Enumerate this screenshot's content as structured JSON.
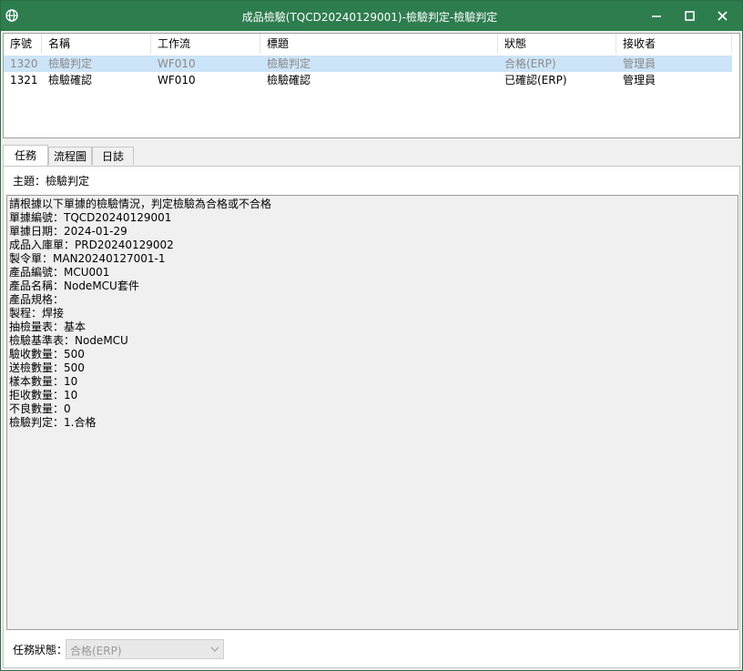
{
  "window": {
    "title": "成品檢驗(TQCD20240129001)-檢驗判定-檢驗判定"
  },
  "grid": {
    "headers": [
      "序號",
      "名稱",
      "工作流",
      "標題",
      "狀態",
      "接收者"
    ],
    "rows": [
      {
        "seq": "1320",
        "name": "檢驗判定",
        "workflow": "WF010",
        "title": "檢驗判定",
        "status": "合格(ERP)",
        "receiver": "管理員"
      },
      {
        "seq": "1321",
        "name": "檢驗確認",
        "workflow": "WF010",
        "title": "檢驗確認",
        "status": "已確認(ERP)",
        "receiver": "管理員"
      }
    ]
  },
  "tabs": [
    "任務",
    "流程圖",
    "日誌"
  ],
  "task": {
    "subject_label": "主題：",
    "subject_value": "檢驗判定",
    "content_lines": [
      "請根據以下單據的檢驗情況，判定檢驗為合格或不合格",
      "單據編號：TQCD20240129001",
      "單據日期：2024-01-29",
      "成品入庫單：PRD20240129002",
      "製令單：MAN20240127001-1",
      "產品編號：MCU001",
      "產品名稱：NodeMCU套件",
      "產品規格：",
      "製程：焊接",
      "抽檢量表：基本",
      "檢驗基準表：NodeMCU",
      "驗收數量：500",
      "送檢數量：500",
      "樣本數量：10",
      "拒收數量：10",
      "不良數量：0",
      "檢驗判定：1.合格"
    ],
    "status_label": "任務狀態：",
    "status_value": "合格(ERP)"
  },
  "icons": {
    "app": "globe-icon",
    "minimize": "minimize-icon",
    "maximize": "maximize-icon",
    "close": "close-icon",
    "dropdown": "chevron-down-icon"
  },
  "colors": {
    "titlebar": "#2e7d4f",
    "selected_row": "#cce4f7"
  }
}
